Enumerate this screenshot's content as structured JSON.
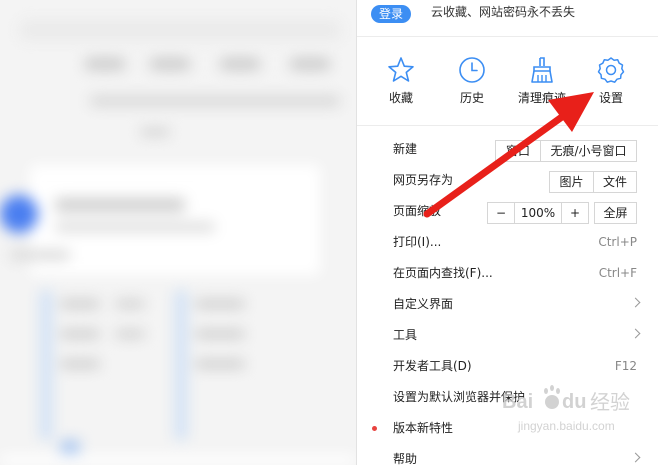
{
  "login": {
    "button": "登录",
    "tip": "云收藏、网站密码永不丢失"
  },
  "quick_actions": [
    {
      "label": "收藏",
      "icon": "star-icon"
    },
    {
      "label": "历史",
      "icon": "clock-icon"
    },
    {
      "label": "清理痕迹",
      "icon": "broom-icon"
    },
    {
      "label": "设置",
      "icon": "gear-icon"
    }
  ],
  "menu": {
    "new": {
      "label": "新建",
      "window_btn": "窗口",
      "incognito_btn": "无痕/小号窗口"
    },
    "save_as": {
      "label": "网页另存为",
      "image_btn": "图片",
      "file_btn": "文件"
    },
    "zoom": {
      "label": "页面缩放",
      "minus": "−",
      "value": "100%",
      "plus": "+",
      "fullscreen": "全屏"
    },
    "print": {
      "label": "打印(I)...",
      "shortcut": "Ctrl+P"
    },
    "find": {
      "label": "在页面内查找(F)...",
      "shortcut": "Ctrl+F"
    },
    "customize": {
      "label": "自定义界面"
    },
    "tools": {
      "label": "工具"
    },
    "devtools": {
      "label": "开发者工具(D)",
      "shortcut": "F12"
    },
    "default_browser": {
      "label": "设置为默认浏览器并保护"
    },
    "whats_new": {
      "label": "版本新特性"
    },
    "help": {
      "label": "帮助"
    }
  },
  "colors": {
    "accent": "#3c8ef3",
    "icon": "#3c8ef3",
    "arrow": "#e8201a",
    "dot": "#e8433f"
  },
  "watermark": {
    "brand": "Baidu",
    "brand_cn": "经验",
    "url": "jingyan.baidu.com"
  }
}
